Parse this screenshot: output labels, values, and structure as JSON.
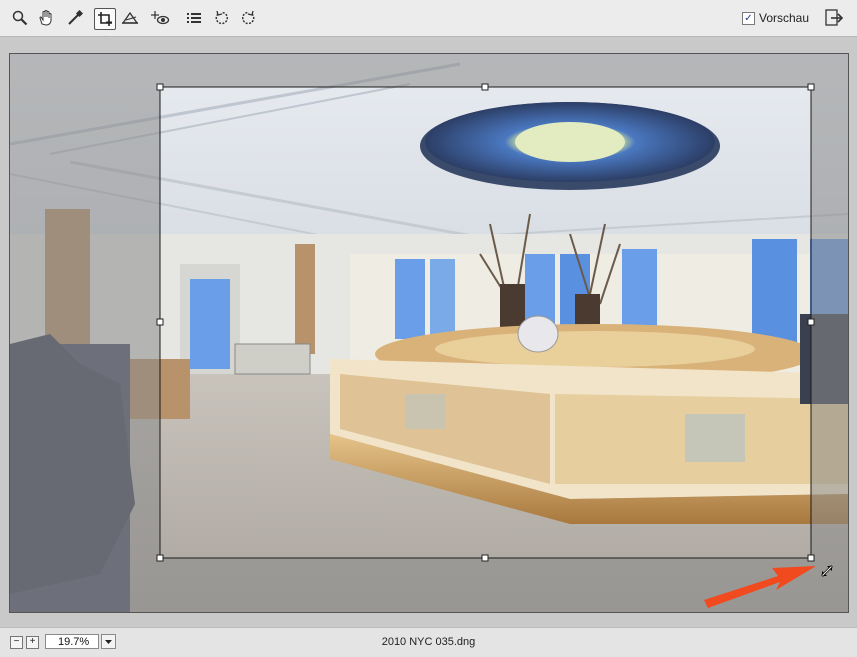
{
  "toolbar": {
    "tools": [
      {
        "name": "zoom-tool",
        "icon": "magnifier-icon"
      },
      {
        "name": "hand-tool",
        "icon": "hand-icon"
      },
      {
        "name": "white-balance-tool",
        "icon": "eyedropper-icon"
      },
      {
        "name": "crop-tool",
        "icon": "crop-icon",
        "active": true
      },
      {
        "name": "straighten-tool",
        "icon": "straighten-icon"
      },
      {
        "name": "red-eye-tool",
        "icon": "red-eye-icon"
      },
      {
        "name": "preferences-tool",
        "icon": "list-icon"
      },
      {
        "name": "rotate-left-tool",
        "icon": "rotate-ccw-icon"
      },
      {
        "name": "rotate-right-tool",
        "icon": "rotate-cw-icon"
      }
    ],
    "preview_label": "Vorschau",
    "preview_checked": true
  },
  "status": {
    "zoom_value": "19.7%",
    "filename": "2010 NYC 035.dng"
  },
  "colors": {
    "annotation_arrow": "#f04a1e",
    "crop_border": "#1a1a1a",
    "overlay": "#8a8a8a"
  }
}
